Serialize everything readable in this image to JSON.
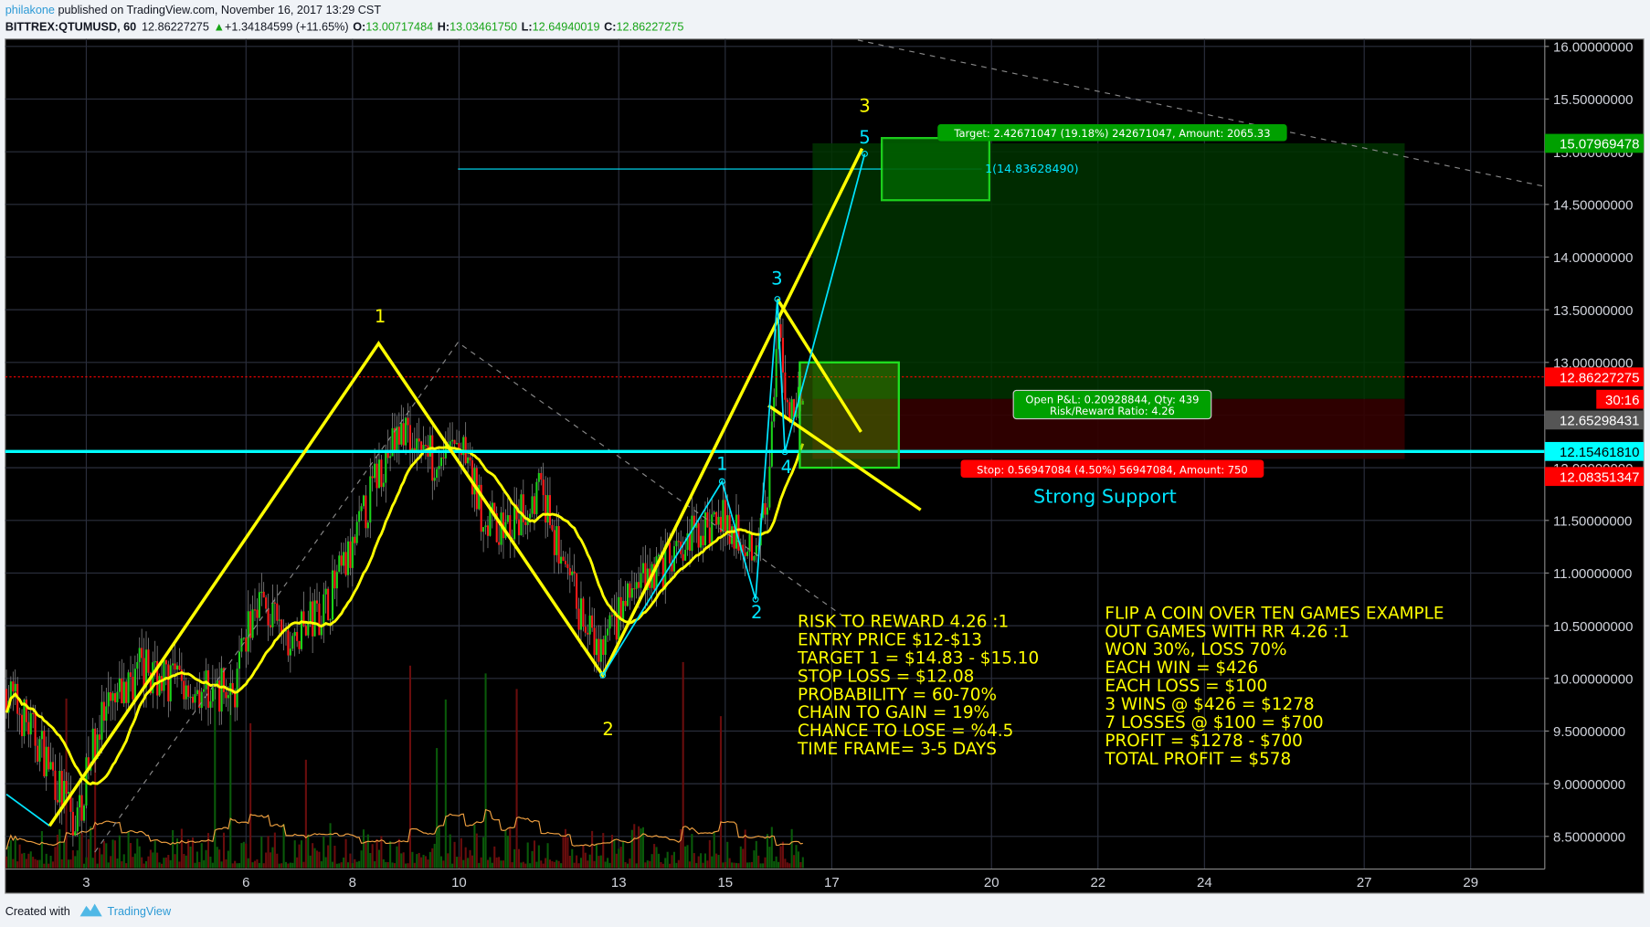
{
  "header": {
    "author": "philakone",
    "published": " published on TradingView.com, November 16, 2017 13:29 CST",
    "symbol": "BITTREX:QTUMUSD, 60",
    "last": "12.86227275",
    "change": "+1.34184599 (+11.65%)",
    "o_label": "O:",
    "o": "13.00717484",
    "h_label": "H:",
    "h": "13.03461750",
    "l_label": "L:",
    "l": "12.64940019",
    "c_label": "C:",
    "c": "12.86227275"
  },
  "footer": {
    "created_with": "Created with",
    "brand": "TradingView"
  },
  "colors": {
    "up": "#19d419",
    "down": "#ff1a1a",
    "drawing": "#ffff00",
    "wave": "#00e5ff",
    "target": "#00a000",
    "stop": "#ff0000",
    "background": "#000000"
  },
  "chart_data": {
    "type": "candlestick",
    "title": "",
    "x_unit": "day of November 2017",
    "x_ticks": [
      3,
      6,
      8,
      10,
      13,
      15,
      17,
      20,
      22,
      24,
      27,
      29
    ],
    "x_tick_labels": [
      "3",
      "6",
      "8",
      "10",
      "13",
      "15",
      "17",
      "20",
      "22",
      "24",
      "27",
      "29"
    ],
    "ylim": [
      8.3,
      16.07
    ],
    "y_ticks": [
      "16.00000000",
      "15.50000000",
      "15.00000000",
      "14.50000000",
      "14.00000000",
      "13.50000000",
      "13.00000000",
      "12.50000000",
      "12.00000000",
      "11.50000000",
      "11.00000000",
      "10.50000000",
      "10.00000000",
      "9.50000000",
      "9.00000000",
      "8.50000000"
    ],
    "grid": true,
    "price_path": [
      [
        1.5,
        9.9
      ],
      [
        2.2,
        9.3
      ],
      [
        2.8,
        8.6
      ],
      [
        3.2,
        9.5
      ],
      [
        4,
        10.1
      ],
      [
        5,
        9.9
      ],
      [
        5.8,
        9.9
      ],
      [
        6.2,
        10.8
      ],
      [
        6.8,
        10.3
      ],
      [
        7.5,
        10.7
      ],
      [
        8,
        11.2
      ],
      [
        8.5,
        12.0
      ],
      [
        9,
        12.4
      ],
      [
        9.5,
        12.1
      ],
      [
        10,
        12.2
      ],
      [
        10.5,
        11.5
      ],
      [
        11,
        11.4
      ],
      [
        11.5,
        11.8
      ],
      [
        12,
        11.0
      ],
      [
        12.6,
        10.2
      ],
      [
        13,
        10.6
      ],
      [
        13.5,
        11.0
      ],
      [
        14,
        11.1
      ],
      [
        14.5,
        11.4
      ],
      [
        15,
        11.5
      ],
      [
        15.5,
        11.3
      ],
      [
        15.8,
        11.6
      ],
      [
        16.0,
        13.3
      ],
      [
        16.2,
        12.5
      ],
      [
        16.5,
        12.86
      ]
    ],
    "price_tags": [
      {
        "value": "15.07969478",
        "price": 15.0797,
        "color": "#00a000",
        "text_color": "#ffffff"
      },
      {
        "value": "12.86227275",
        "price": 12.8623,
        "color": "#ff0000",
        "text_color": "#ffffff"
      },
      {
        "value": "30:16",
        "price": 12.65,
        "color": "#ff0000",
        "text_color": "#ffffff",
        "countdown": true
      },
      {
        "value": "12.65298431",
        "price": 12.453,
        "color": "#555555",
        "text_color": "#ffffff"
      },
      {
        "value": "12.15461810",
        "price": 12.1546,
        "color": "#00ffff",
        "text_color": "#000000"
      },
      {
        "value": "12.08351347",
        "price": 11.917,
        "color": "#ff0000",
        "text_color": "#ffffff"
      }
    ],
    "drawings": {
      "yellow_zigzag": [
        [
          2.31,
          8.6
        ],
        [
          8.49,
          13.18
        ],
        [
          12.7,
          10.03
        ],
        [
          17.57,
          15.03
        ]
      ],
      "yellow_wedge_upper": [
        [
          15.98,
          13.6
        ],
        [
          17.55,
          12.34
        ]
      ],
      "yellow_wedge_lower": [
        [
          15.81,
          12.59
        ],
        [
          18.67,
          11.6
        ]
      ],
      "cyan_wave": [
        [
          12.7,
          10.03
        ],
        [
          14.94,
          11.87
        ],
        [
          15.57,
          10.75
        ],
        [
          15.98,
          13.6
        ],
        [
          16.12,
          12.15
        ],
        [
          17.62,
          14.98
        ]
      ],
      "cyan_left": [
        [
          1.5,
          8.9
        ],
        [
          2.31,
          8.6
        ]
      ],
      "dashed_1": [
        [
          17.49,
          16.06
        ],
        [
          30.39,
          14.67
        ]
      ],
      "dashed_2": [
        [
          3.16,
          8.35
        ],
        [
          9.98,
          13.19
        ],
        [
          17.19,
          10.6
        ]
      ],
      "support_price": 12.1546,
      "last_price": 12.8623,
      "fib_level": {
        "label": "1(14.83628490)",
        "price": 14.8363,
        "from": 9.98,
        "to": 19.96
      },
      "position": {
        "from": 16.64,
        "to": 27.76,
        "target": 15.08,
        "entry": 12.653,
        "stop": 12.0835
      },
      "target_box": {
        "from": 17.94,
        "to": 19.96,
        "top": 15.13,
        "bottom": 14.54
      },
      "entry_box": {
        "from": 16.4,
        "to": 18.26,
        "top": 13.0,
        "bottom": 12.0
      }
    },
    "wave_labels_yellow": [
      {
        "text": "1",
        "d": 8.52,
        "p": 13.38
      },
      {
        "text": "2",
        "d": 12.8,
        "p": 9.46
      },
      {
        "text": "3",
        "d": 17.62,
        "p": 15.38
      }
    ],
    "wave_labels_cyan": [
      {
        "text": "1",
        "d": 14.94,
        "p": 11.98
      },
      {
        "text": "2",
        "d": 15.59,
        "p": 10.57
      },
      {
        "text": "3",
        "d": 15.97,
        "p": 13.74
      },
      {
        "text": "4",
        "d": 16.15,
        "p": 11.95
      },
      {
        "text": "5",
        "d": 17.62,
        "p": 15.08
      }
    ],
    "target_label": "Target: 2.42671047 (19.18%) 242671047, Amount: 2065.33",
    "stop_label": "Stop: 0.56947084 (4.50%) 56947084, Amount: 750",
    "pnl_label_1": "Open P&L: 0.20928844, Qty: 439",
    "pnl_label_2": "Risk/Reward Ratio: 4.26",
    "support_label": "Strong Support",
    "notes_left": [
      "RISK TO REWARD 4.26 :1",
      "ENTRY PRICE $12-$13",
      "TARGET 1 = $14.83 - $15.10",
      "STOP LOSS = $12.08",
      "PROBABILITY = 60-70%",
      "CHAIN TO GAIN = 19%",
      "CHANCE TO LOSE = %4.5",
      "TIME FRAME= 3-5 DAYS"
    ],
    "notes_right": [
      "FLIP A COIN OVER TEN GAMES EXAMPLE",
      "OUT GAMES WITH RR 4.26 :1",
      "WON 30%, LOSS 70%",
      "EACH WIN = $426",
      "EACH LOSS = $100",
      "3 WINS @ $426 = $1278",
      "7 LOSSES @ $100 = $700",
      "PROFIT = $1278 - $700",
      "TOTAL PROFIT = $578"
    ]
  }
}
